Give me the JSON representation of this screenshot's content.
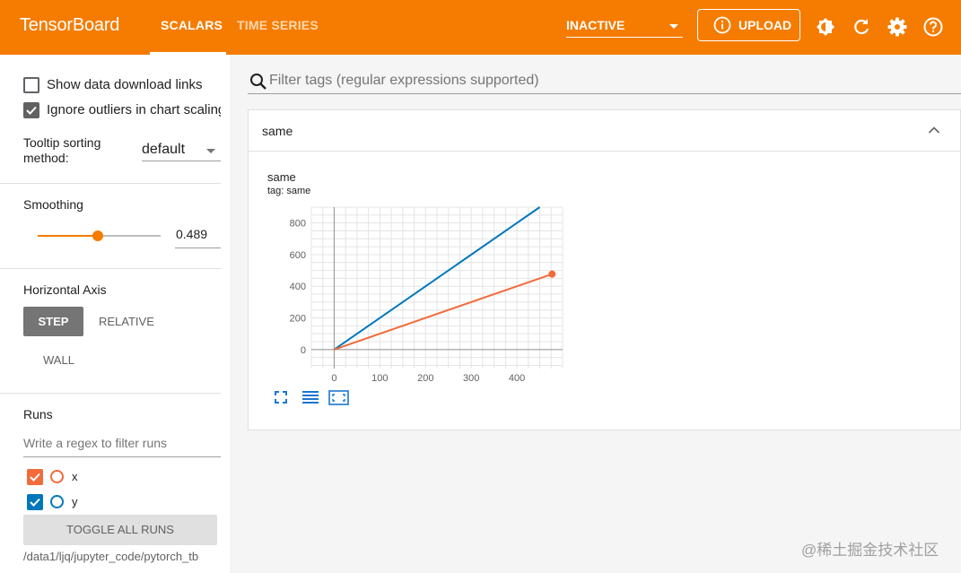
{
  "header": {
    "brand": "TensorBoard",
    "tabs": [
      {
        "label": "SCALARS"
      },
      {
        "label": "TIME SERIES"
      }
    ],
    "status": "INACTIVE",
    "upload_label": "UPLOAD",
    "icons": [
      "theme-icon",
      "refresh-icon",
      "settings-icon",
      "help-icon"
    ],
    "accent": "#f57c00"
  },
  "sidebar": {
    "show_download_links": "Show data download links",
    "ignore_outliers": "Ignore outliers in chart scaling",
    "tooltip_sorting_label": "Tooltip sorting method:",
    "tooltip_sorting_value": "default",
    "smoothing_label": "Smoothing",
    "smoothing_value": "0.489",
    "smoothing_fraction": 0.489,
    "horizontal_axis_label": "Horizontal Axis",
    "axis_options": [
      "STEP",
      "RELATIVE",
      "WALL"
    ],
    "runs_label": "Runs",
    "runs_filter_placeholder": "Write a regex to filter runs",
    "runs": [
      {
        "name": "x",
        "color": "#f26b3a",
        "checked": true
      },
      {
        "name": "y",
        "color": "#0077bb",
        "checked": true
      }
    ],
    "toggle_all": "TOGGLE ALL RUNS",
    "logdir": "/data1/ljq/jupyter_code/pytorch_tb"
  },
  "main": {
    "filter_placeholder": "Filter tags (regular expressions supported)",
    "card_title": "same",
    "chart_name": "same",
    "chart_tag": "tag: same"
  },
  "chart_data": {
    "type": "line",
    "title": "same",
    "subtitle": "tag: same",
    "xlabel": "",
    "ylabel": "",
    "xlim": [
      -50,
      500
    ],
    "ylim": [
      -120,
      900
    ],
    "x_ticks": [
      0,
      100,
      200,
      300,
      400
    ],
    "y_ticks": [
      0,
      200,
      400,
      600,
      800
    ],
    "grid": true,
    "series": [
      {
        "name": "y",
        "color": "#0077bb",
        "x": [
          0,
          450
        ],
        "y": [
          0,
          900
        ]
      },
      {
        "name": "x",
        "color": "#f26b3a",
        "x": [
          0,
          477
        ],
        "y": [
          0,
          477
        ]
      }
    ]
  },
  "watermark": "@稀土掘金技术社区"
}
